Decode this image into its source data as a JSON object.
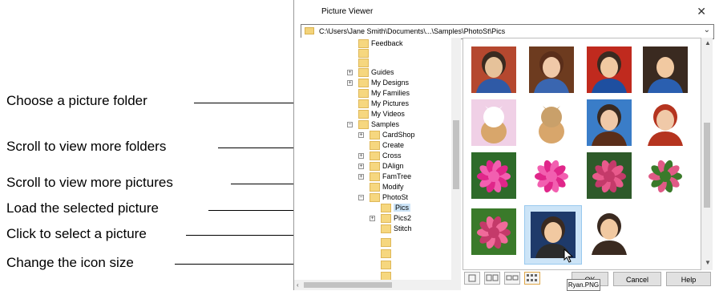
{
  "window": {
    "title": "Picture Viewer",
    "close_glyph": "✕",
    "path_value": "C:\\Users\\Jane Smith\\Documents\\...\\Samples\\PhotoSt\\Pics"
  },
  "callouts": [
    {
      "text": "Choose a picture folder"
    },
    {
      "text": "Scroll to view more folders"
    },
    {
      "text": "Scroll to view more pictures"
    },
    {
      "text": "Load the selected picture"
    },
    {
      "text": "Click to select a picture"
    },
    {
      "text": "Change the icon size"
    }
  ],
  "tree": [
    {
      "label": "Feedback",
      "expander": ""
    },
    {
      "label": "Guides",
      "expander": "+"
    },
    {
      "label": "My Designs",
      "expander": "+"
    },
    {
      "label": "My Families",
      "expander": ""
    },
    {
      "label": "My Pictures",
      "expander": ""
    },
    {
      "label": "My Videos",
      "expander": ""
    },
    {
      "label": "Samples",
      "expander": "−"
    },
    {
      "label": "CardShop",
      "expander": "+"
    },
    {
      "label": "Create",
      "expander": ""
    },
    {
      "label": "Cross",
      "expander": "+"
    },
    {
      "label": "DAlign",
      "expander": "+"
    },
    {
      "label": "FamTree",
      "expander": "+"
    },
    {
      "label": "Modify",
      "expander": ""
    },
    {
      "label": "PhotoSt",
      "expander": "−"
    },
    {
      "label": "Pics",
      "expander": ""
    },
    {
      "label": "Pics2",
      "expander": "+"
    },
    {
      "label": "Stitch",
      "expander": ""
    }
  ],
  "thumbnails": [
    {
      "subject": "two children portrait",
      "colors": [
        "#b5482f",
        "#e6c29a",
        "#2f5aa6"
      ]
    },
    {
      "subject": "girl portrait",
      "colors": [
        "#6d3b1f",
        "#f0c9a8",
        "#ffffff"
      ]
    },
    {
      "subject": "boy red background",
      "colors": [
        "#c02a1e",
        "#f1c9a1",
        "#1e4fa0"
      ]
    },
    {
      "subject": "boy portrait",
      "colors": [
        "#3a2a20",
        "#f1c9a1",
        "#2a5fb0"
      ]
    },
    {
      "subject": "kitten pink",
      "colors": [
        "#f0d0e6",
        "#d8a66b",
        "#ffffff"
      ]
    },
    {
      "subject": "kitten white",
      "colors": [
        "#ffffff",
        "#d8a66b",
        "#c9a06a"
      ]
    },
    {
      "subject": "girl blue background",
      "colors": [
        "#3a7dc8",
        "#f0c9a8",
        "#5a2e1a"
      ]
    },
    {
      "subject": "girl red hair",
      "colors": [
        "#ffffff",
        "#f0c9a8",
        "#b5341f"
      ]
    },
    {
      "subject": "pink dahlia",
      "colors": [
        "#2e6b2a",
        "#e0268a",
        "#f25fb0"
      ]
    },
    {
      "subject": "pink dahlia white",
      "colors": [
        "#ffffff",
        "#e0268a",
        "#f25fb0"
      ]
    },
    {
      "subject": "pink rose",
      "colors": [
        "#2e5a2a",
        "#e85a8c",
        "#c43a6a"
      ]
    },
    {
      "subject": "rose bud",
      "colors": [
        "#ffffff",
        "#e05a86",
        "#3a7a2a"
      ]
    },
    {
      "subject": "pink rose green",
      "colors": [
        "#3a7a2a",
        "#f06a9a",
        "#c43a6a"
      ]
    },
    {
      "subject": "school portrait Ryan",
      "colors": [
        "#1e3a6a",
        "#f1c9a1",
        "#2b2b2b"
      ]
    },
    {
      "subject": "boy smiling",
      "colors": [
        "#ffffff",
        "#f1c9a1",
        "#3a2a20"
      ]
    }
  ],
  "tooltip": "Ryan.PNG",
  "buttons": {
    "ok": "OK",
    "cancel": "Cancel",
    "help": "Help"
  },
  "icon_sizes": [
    "small-icon-view",
    "medium-icon-view",
    "large-icon-view",
    "grid-icon-view"
  ]
}
